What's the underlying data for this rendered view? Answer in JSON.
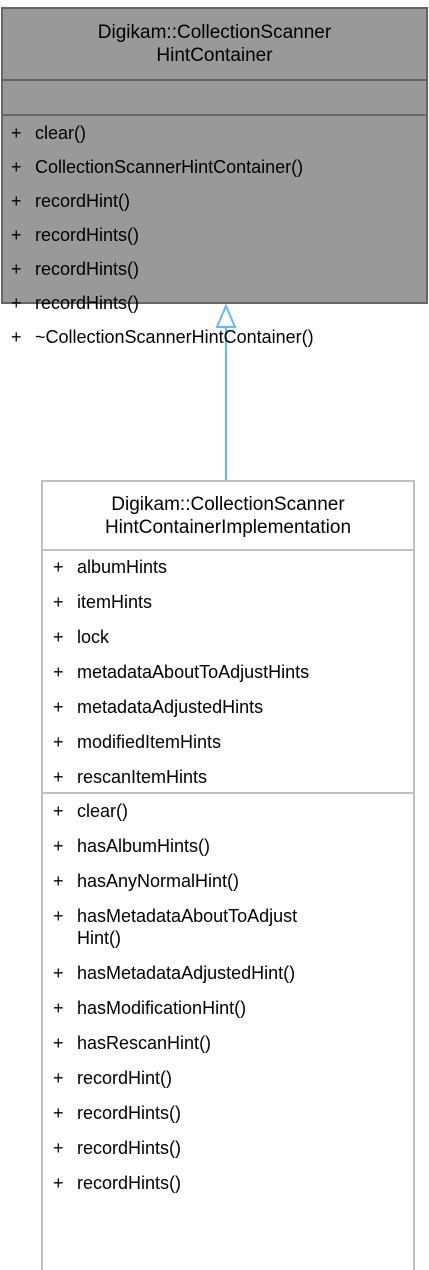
{
  "parent": {
    "title": "Digikam::CollectionScanner\nHintContainer",
    "attributes": [],
    "operations": [
      {
        "vis": "+",
        "name": "clear()"
      },
      {
        "vis": "+",
        "name": "CollectionScannerHintContainer()"
      },
      {
        "vis": "+",
        "name": "recordHint()"
      },
      {
        "vis": "+",
        "name": "recordHints()"
      },
      {
        "vis": "+",
        "name": "recordHints()"
      },
      {
        "vis": "+",
        "name": "recordHints()"
      },
      {
        "vis": "+",
        "name": "~CollectionScannerHintContainer()"
      }
    ]
  },
  "child": {
    "title": "Digikam::CollectionScanner\nHintContainerImplementation",
    "attributes": [
      {
        "vis": "+",
        "name": "albumHints"
      },
      {
        "vis": "+",
        "name": "itemHints"
      },
      {
        "vis": "+",
        "name": "lock"
      },
      {
        "vis": "+",
        "name": "metadataAboutToAdjustHints"
      },
      {
        "vis": "+",
        "name": "metadataAdjustedHints"
      },
      {
        "vis": "+",
        "name": "modifiedItemHints"
      },
      {
        "vis": "+",
        "name": "rescanItemHints"
      }
    ],
    "operations": [
      {
        "vis": "+",
        "name": "clear()"
      },
      {
        "vis": "+",
        "name": "hasAlbumHints()"
      },
      {
        "vis": "+",
        "name": "hasAnyNormalHint()"
      },
      {
        "vis": "+",
        "name": "hasMetadataAboutToAdjust\nHint()"
      },
      {
        "vis": "+",
        "name": "hasMetadataAdjustedHint()"
      },
      {
        "vis": "+",
        "name": "hasModificationHint()"
      },
      {
        "vis": "+",
        "name": "hasRescanHint()"
      },
      {
        "vis": "+",
        "name": "recordHint()"
      },
      {
        "vis": "+",
        "name": "recordHints()"
      },
      {
        "vis": "+",
        "name": "recordHints()"
      },
      {
        "vis": "+",
        "name": "recordHints()"
      }
    ]
  },
  "colors": {
    "parent_fill": "#999999",
    "parent_border": "#666666",
    "child_border": "#bfbfbf",
    "inheritance_arrow": "#63b8ff"
  }
}
